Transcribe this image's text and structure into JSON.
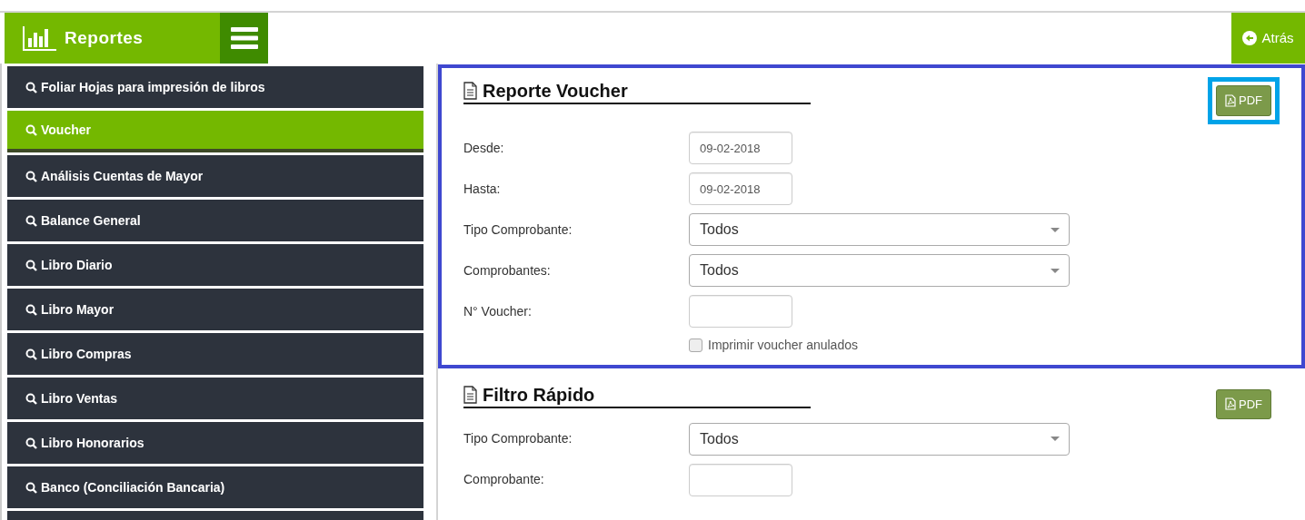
{
  "header": {
    "title": "Reportes",
    "back_button": "Atrás"
  },
  "sidebar": {
    "items": [
      {
        "label": "Foliar Hojas para impresión de libros",
        "selected": false
      },
      {
        "label": "Voucher",
        "selected": true
      },
      {
        "label": "Análisis Cuentas de Mayor",
        "selected": false
      },
      {
        "label": "Balance General",
        "selected": false
      },
      {
        "label": "Libro Diario",
        "selected": false
      },
      {
        "label": "Libro Mayor",
        "selected": false
      },
      {
        "label": "Libro Compras",
        "selected": false
      },
      {
        "label": "Libro Ventas",
        "selected": false
      },
      {
        "label": "Libro Honorarios",
        "selected": false
      },
      {
        "label": "Banco (Conciliación Bancaria)",
        "selected": false
      }
    ]
  },
  "sections": [
    {
      "title": "Reporte Voucher",
      "highlighted": true,
      "pdf_button": {
        "label": "PDF",
        "highlighted": true
      },
      "fields": [
        {
          "kind": "date",
          "label": "Desde:",
          "value": "09-02-2018"
        },
        {
          "kind": "date",
          "label": "Hasta:",
          "value": "09-02-2018"
        },
        {
          "kind": "select",
          "label": "Tipo Comprobante:",
          "value": "Todos"
        },
        {
          "kind": "select",
          "label": "Comprobantes:",
          "value": "Todos"
        },
        {
          "kind": "text",
          "label": "N° Voucher:"
        },
        {
          "kind": "checkbox",
          "label": "Imprimir voucher anulados",
          "checked": false
        }
      ]
    },
    {
      "title": "Filtro Rápido",
      "highlighted": false,
      "pdf_button": {
        "label": "PDF",
        "highlighted": false
      },
      "fields": [
        {
          "kind": "select",
          "label": "Tipo Comprobante:",
          "value": "Todos"
        },
        {
          "kind": "text",
          "label": "Comprobante:"
        }
      ]
    }
  ]
}
